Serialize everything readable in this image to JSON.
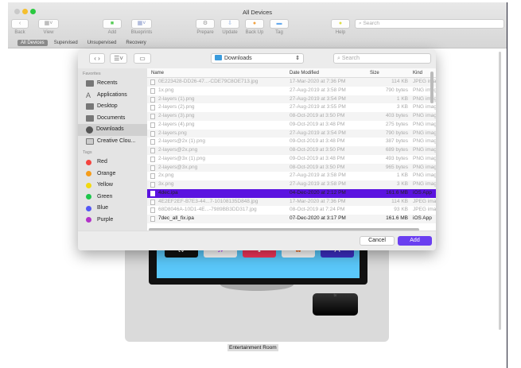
{
  "window": {
    "title": "All Devices"
  },
  "toolbar": {
    "back": "Back",
    "view": "View",
    "add": "Add",
    "blueprints": "Blueprints",
    "prepare": "Prepare",
    "update": "Update",
    "backup": "Back Up",
    "tag": "Tag",
    "help": "Help",
    "search_placeholder": "Search"
  },
  "segments": [
    "All Devices",
    "Supervised",
    "Unsupervised",
    "Recovery"
  ],
  "device": {
    "label": "Entertainment Room",
    "tv_app": "tv",
    "box_label": "tv"
  },
  "dialog": {
    "location": "Downloads",
    "search_placeholder": "Search",
    "sidebar": {
      "favorites_header": "Favorites",
      "favorites": [
        "Recents",
        "Applications",
        "Desktop",
        "Documents",
        "Downloads",
        "Creative Clou..."
      ],
      "tags_header": "Tags",
      "tags": [
        {
          "name": "Red",
          "color": "#f4443f"
        },
        {
          "name": "Orange",
          "color": "#f59c1a"
        },
        {
          "name": "Yellow",
          "color": "#f2d90f"
        },
        {
          "name": "Green",
          "color": "#1dc64c"
        },
        {
          "name": "Blue",
          "color": "#5457f5"
        },
        {
          "name": "Purple",
          "color": "#b232c9"
        }
      ]
    },
    "columns": [
      "Name",
      "Date Modified",
      "Size",
      "Kind"
    ],
    "files": [
      [
        "0E223428-DD26-47...-CDE79C8OE713.jpg",
        "17-Mar-2020 at 7:36 PM",
        "114 KB",
        "JPEG image"
      ],
      [
        "1x.png",
        "27-Aug-2019 at 3:58 PM",
        "790 bytes",
        "PNG image"
      ],
      [
        "2-layers (1).png",
        "27-Aug-2019 at 3:54 PM",
        "1 KB",
        "PNG image"
      ],
      [
        "2-layers (2).png",
        "27-Aug-2019 at 3:55 PM",
        "3 KB",
        "PNG image"
      ],
      [
        "2-layers (3).png",
        "08-Oct-2019 at 3:50 PM",
        "403 bytes",
        "PNG image"
      ],
      [
        "2-layers (4).png",
        "09-Oct-2019 at 3:48 PM",
        "275 bytes",
        "PNG image"
      ],
      [
        "2-layers.png",
        "27-Aug-2019 at 3:54 PM",
        "790 bytes",
        "PNG image"
      ],
      [
        "2-layers@2x (1).png",
        "09-Oct-2019 at 3:48 PM",
        "387 bytes",
        "PNG image"
      ],
      [
        "2-layers@2x.png",
        "08-Oct-2019 at 3:50 PM",
        "689 bytes",
        "PNG image"
      ],
      [
        "2-layers@3x (1).png",
        "09-Oct-2019 at 3:48 PM",
        "493 bytes",
        "PNG image"
      ],
      [
        "2-layers@3x.png",
        "08-Oct-2019 at 3:50 PM",
        "965 bytes",
        "PNG image"
      ],
      [
        "2x.png",
        "27-Aug-2019 at 3:58 PM",
        "1 KB",
        "PNG image"
      ],
      [
        "3x.png",
        "27-Aug-2019 at 3:58 PM",
        "3 KB",
        "PNG image"
      ],
      [
        "4dec.ipa",
        "04-Dec-2020 at 2:12 PM",
        "161.6 MB",
        "iOS App"
      ],
      [
        "4E2EF2EF-B7E3-44...7-10108135D848.jpg",
        "17-Mar-2020 at 7:36 PM",
        "114 KB",
        "JPEG image"
      ],
      [
        "68D8046A-10D1-4E...-7989BB3DD317.jpg",
        "08-Oct-2019 at 7:24 PM",
        "93 KB",
        "JPEG image"
      ],
      [
        "7dec_all_fix.ipa",
        "07-Dec-2020 at 3:17 PM",
        "161.6 MB",
        "iOS App"
      ]
    ],
    "selected_index": 13,
    "cancel": "Cancel",
    "add": "Add"
  }
}
